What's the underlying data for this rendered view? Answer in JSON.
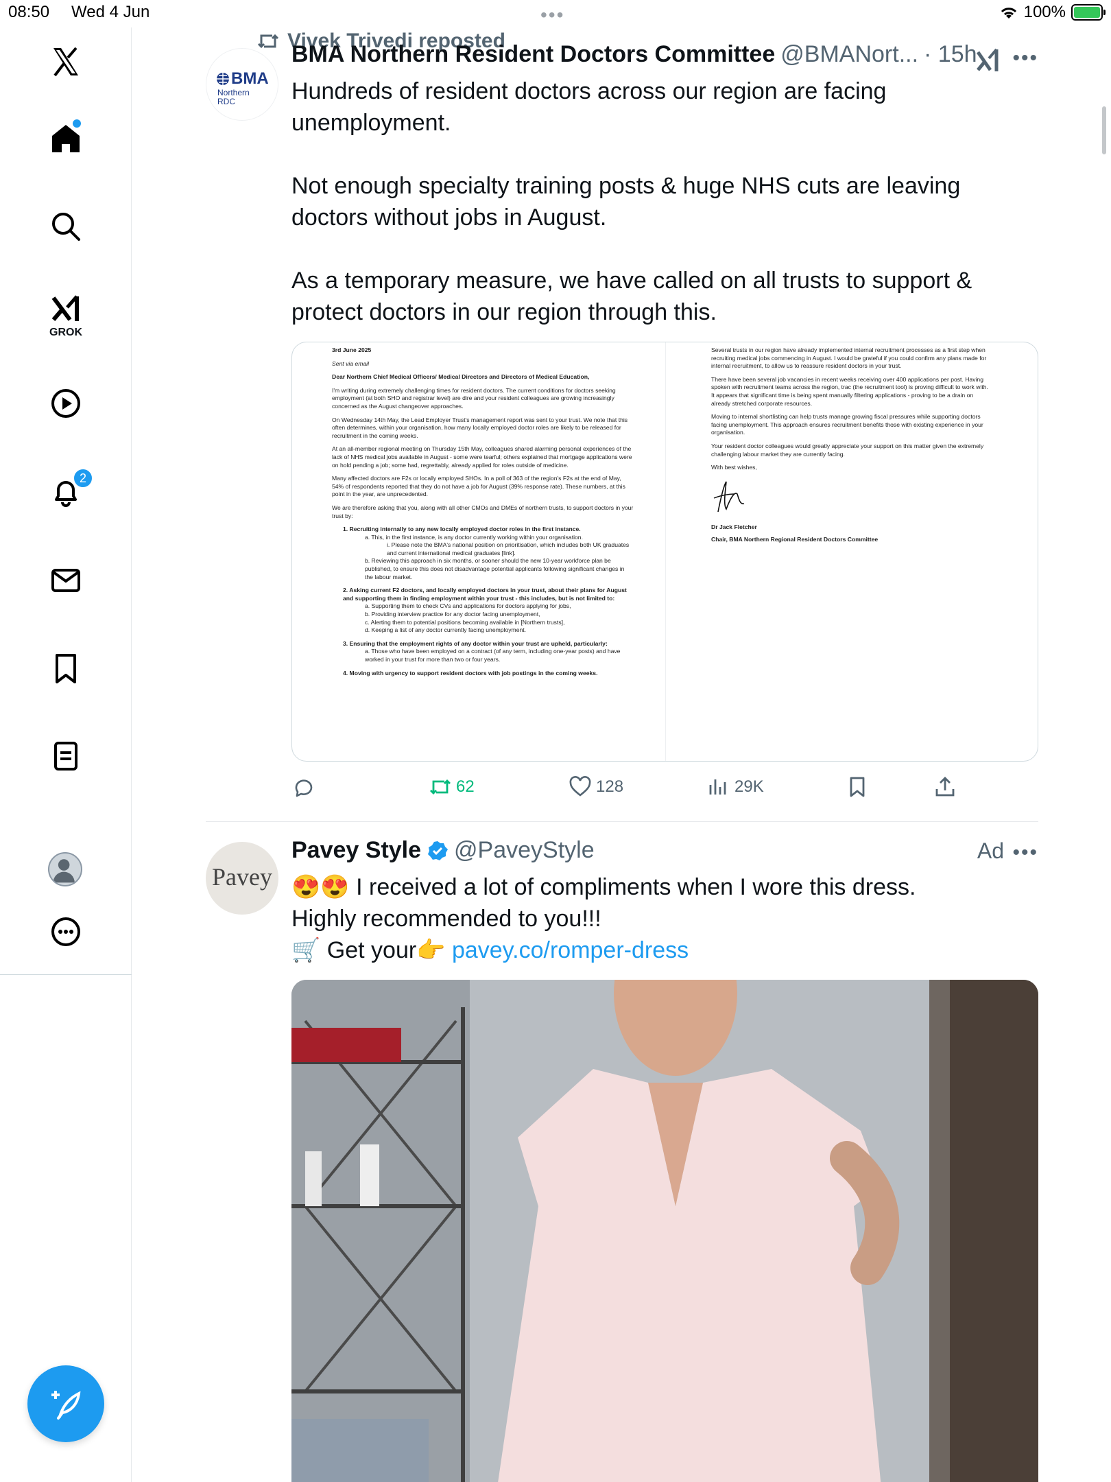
{
  "status_bar": {
    "time": "08:50",
    "date": "Wed 4 Jun",
    "battery": "100%"
  },
  "sidebar": {
    "grok_label": "GROK",
    "notifications_count": "2"
  },
  "repost": {
    "text": "Vivek Trivedi reposted"
  },
  "post1": {
    "avatar_brand": "BMA",
    "avatar_sub1": "Northern",
    "avatar_sub2": "RDC",
    "name": "BMA Northern Resident Doctors Committee",
    "handle": "@BMANort...",
    "time": "· 15h",
    "paragraphs": [
      "Hundreds of resident doctors across our region are facing unemployment.",
      "Not enough specialty training posts & huge NHS cuts are leaving doctors without jobs in August.",
      "As a temporary measure, we have called on all trusts to support & protect doctors in our region through this."
    ],
    "letter_left": {
      "date": "3rd June 2025",
      "sent": "Sent via email",
      "salutation": "Dear Northern Chief Medical Officers/ Medical Directors and Directors of Medical Education,",
      "p1": "I'm writing during extremely challenging times for resident doctors. The current conditions for doctors seeking employment (at both SHO and registrar level) are dire and your resident colleagues are growing increasingly concerned as the August changeover approaches.",
      "p2": "On Wednesday 14th May, the Lead Employer Trust's management report was sent to your trust. We note that this often determines, within your organisation, how many locally employed doctor roles are likely to be released for recruitment in the coming weeks.",
      "p3": "At an all-member regional meeting on Thursday 15th May, colleagues shared alarming personal experiences of the lack of NHS medical jobs available in August - some were tearful; others explained that mortgage applications were on hold pending a job; some had, regrettably, already applied for roles outside of medicine.",
      "p4": "Many affected doctors are F2s or locally employed SHOs. In a poll of 363 of the region's F2s at the end of May, 54% of respondents reported that they do not have a job for August (39% response rate). These numbers, at this point in the year, are unprecedented.",
      "p5": "We are therefore asking that you, along with all other CMOs and DMEs of northern trusts, to support doctors in your trust by:",
      "item1": "1.  Recruiting internally to any new locally employed doctor roles in the first instance.",
      "item1a": "a.  This, in the first instance, is any doctor currently working within your organisation.",
      "item1ai": "i.  Please note the BMA's national position on prioritisation, which includes both UK graduates and current international medical graduates [link].",
      "item1b": "b.  Reviewing this approach in six months, or sooner should the new 10-year workforce plan be published, to ensure this does not disadvantage potential applicants following significant changes in the labour market.",
      "item2": "2.  Asking current F2 doctors, and locally employed doctors in your trust, about their plans for August and supporting them in finding employment within your trust - this includes, but is not limited to:",
      "item2a": "a.  Supporting them to check CVs and applications for doctors applying for jobs,",
      "item2b": "b.  Providing interview practice for any doctor facing unemployment,",
      "item2c": "c.  Alerting them to potential positions becoming available in [Northern trusts],",
      "item2d": "d.  Keeping a list of any doctor currently facing unemployment.",
      "item3": "3.  Ensuring that the employment rights of any doctor within your trust are upheld, particularly:",
      "item3a": "a.  Those who have been employed on a contract (of any term, including one-year posts) and have worked in your trust for more than two or four years.",
      "item4": "4.  Moving with urgency to support resident doctors with job postings in the coming weeks."
    },
    "letter_right": {
      "p1": "Several trusts in our region have already implemented internal recruitment processes as a first step when recruiting medical jobs commencing in August. I would be grateful if you could confirm any plans made for internal recruitment, to allow us to reassure resident doctors in your trust.",
      "p2": "There have been several job vacancies in recent weeks receiving over 400 applications per post. Having spoken with recruitment teams across the region, trac (the recruitment tool) is proving difficult to work with. It appears that significant time is being spent manually filtering applications - proving to be a drain on already stretched corporate resources.",
      "p3": "Moving to internal shortlisting can help trusts manage growing fiscal pressures while supporting doctors facing unemployment. This approach ensures recruitment benefits those with existing experience in your organisation.",
      "p4": "Your resident doctor colleagues would greatly appreciate your support on this matter given the extremely challenging labour market they are currently facing.",
      "closing": "With best wishes,",
      "signer": "Dr Jack Fletcher",
      "signer_title": "Chair, BMA Northern Regional Resident Doctors Committee"
    },
    "stats": {
      "reposts": "62",
      "likes": "128",
      "views": "29K"
    }
  },
  "post2": {
    "avatar_text": "Pavey",
    "name": "Pavey Style",
    "handle": "@PaveyStyle",
    "ad_label": "Ad",
    "line1": "😍😍 I received a lot of compliments when I wore this dress. Highly recommended to you!!!",
    "line2_prefix": "🛒 Get your👉 ",
    "link": "pavey.co/romper-dress"
  },
  "colors": {
    "accent": "#1d9bf0",
    "repost_green": "#00ba7c",
    "muted": "#536471"
  }
}
